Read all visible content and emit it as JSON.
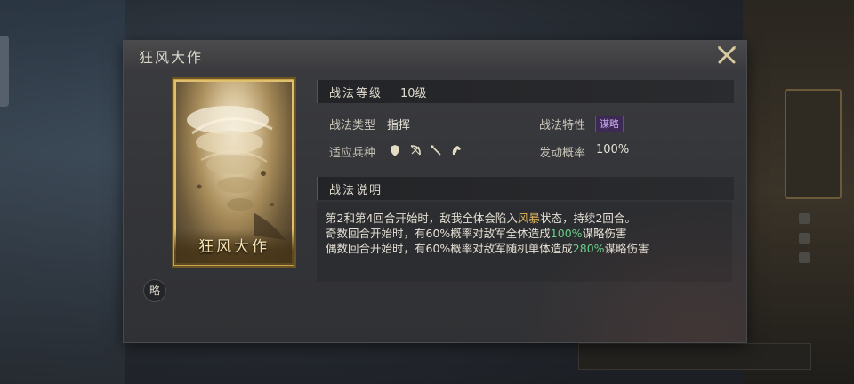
{
  "dialog": {
    "title": "狂风大作",
    "close_icon": "close-x-icon"
  },
  "card": {
    "name": "狂风大作",
    "art": "tornado-storm-art"
  },
  "badge": "略",
  "level": {
    "label": "战法等级",
    "value": "10级"
  },
  "attributes": {
    "type_label": "战法类型",
    "type_value": "指挥",
    "trait_label": "战法特性",
    "trait_value": "谋略",
    "troop_label": "适应兵种",
    "troop_icons": [
      "shield-icon",
      "bow-icon",
      "spear-icon",
      "cavalry-icon"
    ],
    "rate_label": "发动概率",
    "rate_value": "100%"
  },
  "description": {
    "header": "战法说明",
    "line1": {
      "a": "第2和第4回合开始时，敌我全体会陷入",
      "b": "风暴",
      "c": "状态，持续2回合。"
    },
    "line2": {
      "a": "奇数回合开始时，有60%概率对敌军全体造成",
      "b": "100%",
      "c": "谋略伤害"
    },
    "line3": {
      "a": "偶数回合开始时，有60%概率对敌军随机单体造成",
      "b": "280%",
      "c": "谋略伤害"
    }
  },
  "colors": {
    "highlight_gold": "#e0b55a",
    "highlight_green": "#69d08a",
    "card_border": "#c8a24c",
    "tag_purple": "#6a4a93"
  }
}
